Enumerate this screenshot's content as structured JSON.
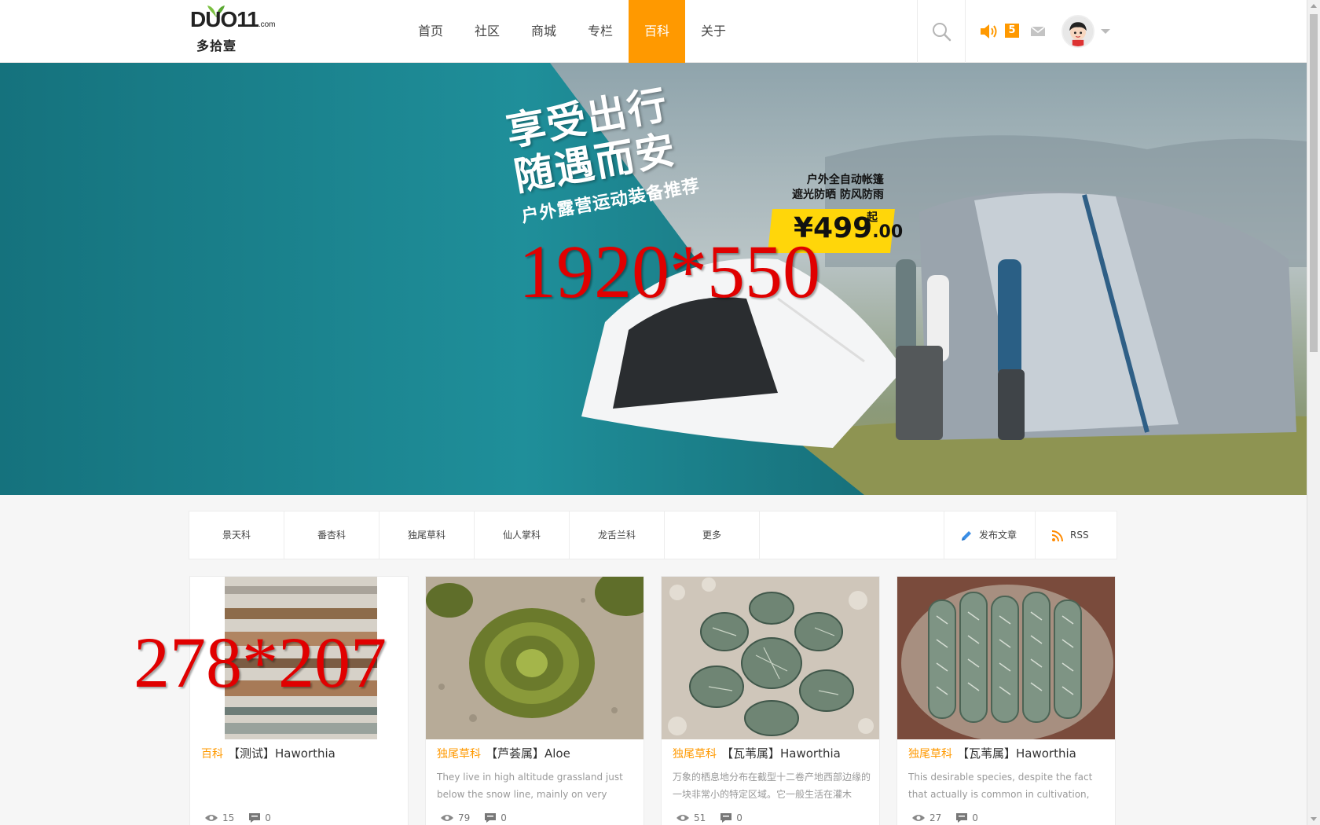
{
  "header": {
    "logo_text": "DUO11",
    "logo_suffix": ".com",
    "logo_cn": "多拾壹",
    "nav": [
      {
        "label": "首页"
      },
      {
        "label": "社区"
      },
      {
        "label": "商城"
      },
      {
        "label": "专栏"
      },
      {
        "label": "百科",
        "active": true
      },
      {
        "label": "关于"
      }
    ],
    "notification_count": "5",
    "accent_color": "#ff9900"
  },
  "banner": {
    "headline_1": "享受出行",
    "headline_2": "随遇而安",
    "headline_3": "户外露营运动装备推荐",
    "sub_1": "户外全自动帐篷",
    "sub_2": "遮光防晒 防风防雨",
    "price_main": "¥499",
    "price_dec": ".00",
    "price_from": "起",
    "size_note": "1920*550"
  },
  "catbar": {
    "items": [
      "景天科",
      "番杏科",
      "独尾草科",
      "仙人掌科",
      "龙舌兰科",
      "更多"
    ],
    "publish_label": "发布文章",
    "rss_label": "RSS"
  },
  "thumb_size_note": "278*207",
  "cards": [
    {
      "category": "百科",
      "title": "【测试】Haworthia",
      "excerpt": "",
      "views": "15",
      "comments": "0"
    },
    {
      "category": "独尾草科",
      "title": "【芦荟属】Aloe",
      "excerpt": "They live in high altitude grassland just below the snow line, mainly on very steep",
      "views": "79",
      "comments": "0"
    },
    {
      "category": "独尾草科",
      "title": "【瓦苇属】Haworthia",
      "excerpt": "万象的栖息地分布在截型十二卷产地西部边缘的一块非常小的特定区域。它一般生活在灌木",
      "views": "51",
      "comments": "0"
    },
    {
      "category": "独尾草科",
      "title": "【瓦苇属】Haworthia",
      "excerpt": "This desirable species, despite the fact that actually is common in cultivation, still",
      "views": "27",
      "comments": "0"
    }
  ]
}
